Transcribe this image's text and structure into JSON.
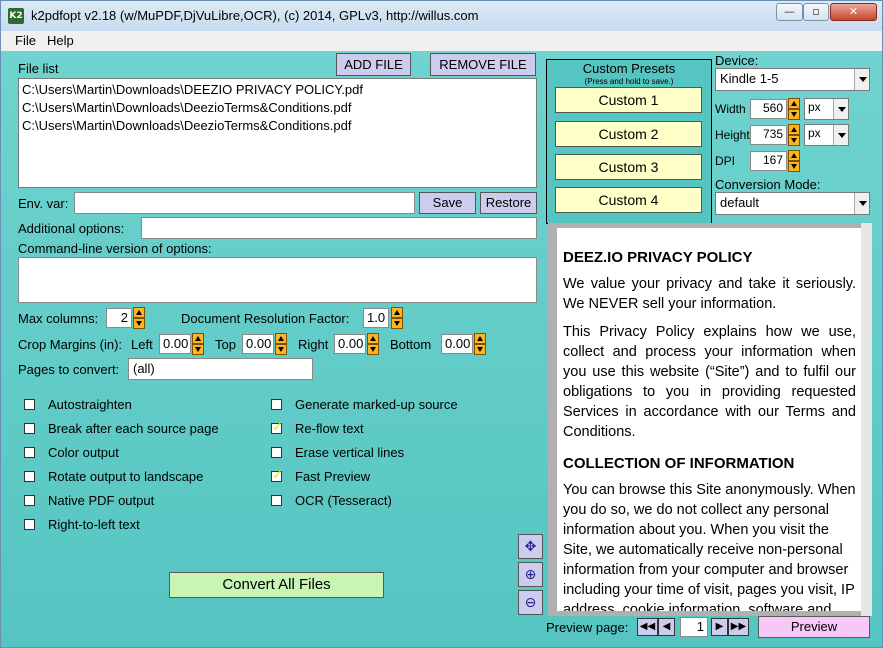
{
  "window": {
    "title": "k2pdfopt v2.18 (w/MuPDF,DjVuLibre,OCR), (c) 2014, GPLv3, http://willus.com",
    "icon": "k2-app-icon"
  },
  "menu": [
    "File",
    "Help"
  ],
  "file_list": {
    "label": "File list",
    "add_button": "ADD FILE",
    "remove_button": "REMOVE FILE",
    "files": [
      "C:\\Users\\Martin\\Downloads\\DEEZIO PRIVACY POLICY.pdf",
      "C:\\Users\\Martin\\Downloads\\DeezioTerms&Conditions.pdf",
      "C:\\Users\\Martin\\Downloads\\DeezioTerms&Conditions.pdf"
    ]
  },
  "env": {
    "label": "Env. var:",
    "value": "",
    "save_button": "Save",
    "restore_button": "Restore"
  },
  "additional": {
    "label": "Additional options:",
    "value": ""
  },
  "cmdline": {
    "label": "Command-line version of options:",
    "value": ""
  },
  "max_columns": {
    "label": "Max columns:",
    "value": "2"
  },
  "resolution": {
    "label": "Document Resolution Factor:",
    "value": "1.0"
  },
  "crop": {
    "label": "Crop Margins (in):",
    "left_label": "Left",
    "left": "0.00",
    "top_label": "Top",
    "top": "0.00",
    "right_label": "Right",
    "right": "0.00",
    "bottom_label": "Bottom",
    "bottom": "0.00"
  },
  "pages": {
    "label": "Pages to convert:",
    "value": "(all)"
  },
  "options_left": [
    {
      "label": "Autostraighten",
      "checked": false
    },
    {
      "label": "Break after each source page",
      "checked": false
    },
    {
      "label": "Color output",
      "checked": false
    },
    {
      "label": "Rotate output to landscape",
      "checked": false
    },
    {
      "label": "Native PDF output",
      "checked": false
    },
    {
      "label": "Right-to-left text",
      "checked": false
    }
  ],
  "options_right": [
    {
      "label": "Generate marked-up source",
      "checked": false
    },
    {
      "label": "Re-flow text",
      "checked": true
    },
    {
      "label": "Erase vertical lines",
      "checked": false
    },
    {
      "label": "Fast Preview",
      "checked": true
    },
    {
      "label": "OCR (Tesseract)",
      "checked": false
    }
  ],
  "convert_button": "Convert All Files",
  "presets": {
    "title": "Custom Presets",
    "subtitle": "(Press and hold to save.)",
    "buttons": [
      "Custom 1",
      "Custom 2",
      "Custom 3",
      "Custom 4"
    ]
  },
  "device": {
    "label": "Device:",
    "value": "Kindle 1-5"
  },
  "width": {
    "label": "Width",
    "value": "560",
    "unit": "px"
  },
  "height": {
    "label": "Height",
    "value": "735",
    "unit": "px"
  },
  "dpi": {
    "label": "DPI",
    "value": "167"
  },
  "conversion": {
    "label": "Conversion Mode:",
    "value": "default"
  },
  "preview_doc": {
    "heading1": "DEEZ.IO PRIVACY POLICY",
    "p1": "We value your privacy and take it seriously. We NEVER sell your information.",
    "p2": "This Privacy Policy explains how we use, collect and process your information when you use this website (“Site”) and to fulfil our obligations to you in providing requested Services in accordance with our Terms and Conditions.",
    "heading2": "COLLECTION OF INFORMATION",
    "p3": "You can browse this Site anonymously. When you do so, we do not collect any personal information about you.  When you visit the Site, we automatically receive non-personal information from your computer and browser including your time of visit, pages you visit, IP address, cookie information, software and hardware"
  },
  "preview_nav": {
    "label": "Preview page:",
    "page": "1",
    "preview_button": "Preview"
  }
}
